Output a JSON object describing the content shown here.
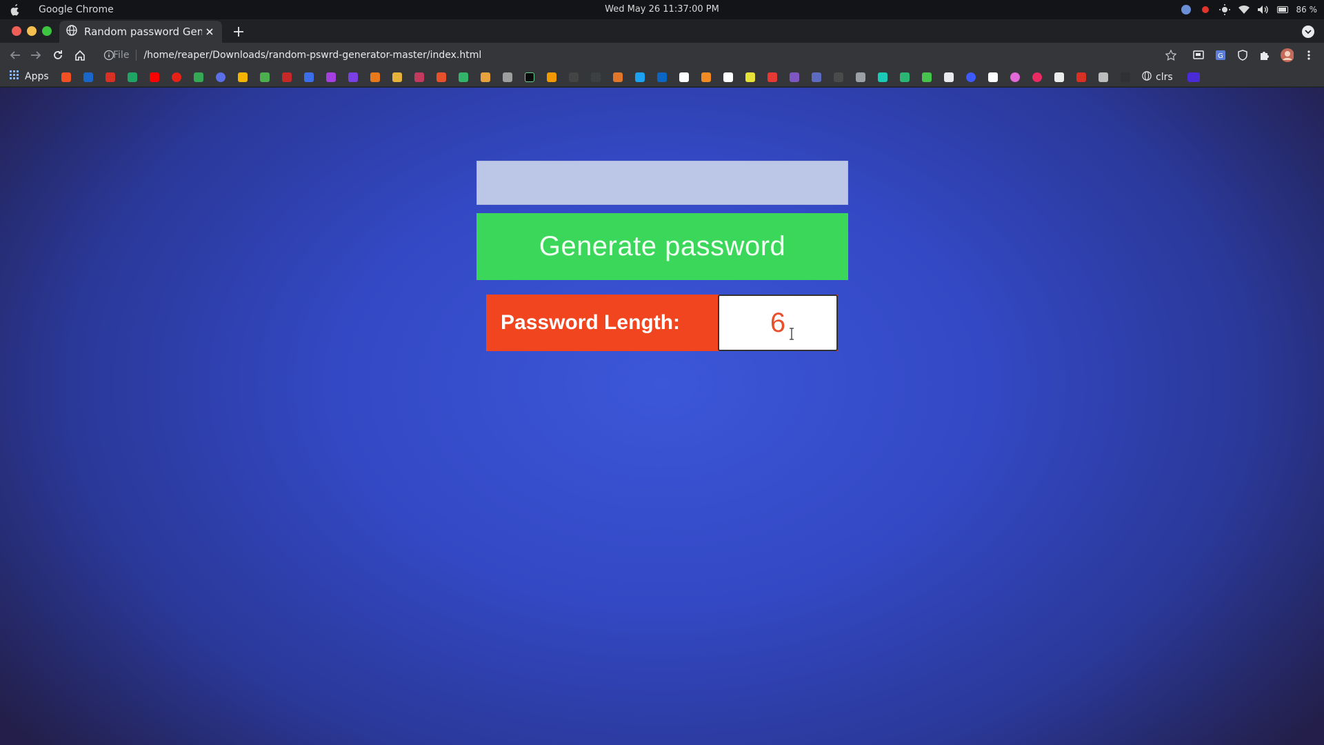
{
  "os_bar": {
    "app_name": "Google Chrome",
    "clock": "Wed May 26  11:37:00 PM",
    "battery": "86 %"
  },
  "browser": {
    "tab_title": "Random password Generator",
    "url_scheme": "File",
    "url": "/home/reaper/Downloads/random-pswrd-generator-master/index.html",
    "bookmarks": {
      "apps_label": "Apps",
      "last_label": "clrs"
    }
  },
  "page": {
    "password_output": "",
    "generate_button": "Generate password",
    "length_label": "Password Length:",
    "length_value": "6"
  },
  "colors": {
    "generate_green": "#3bd75b",
    "length_red": "#f0451f",
    "background_blue": "#3c57d9"
  }
}
